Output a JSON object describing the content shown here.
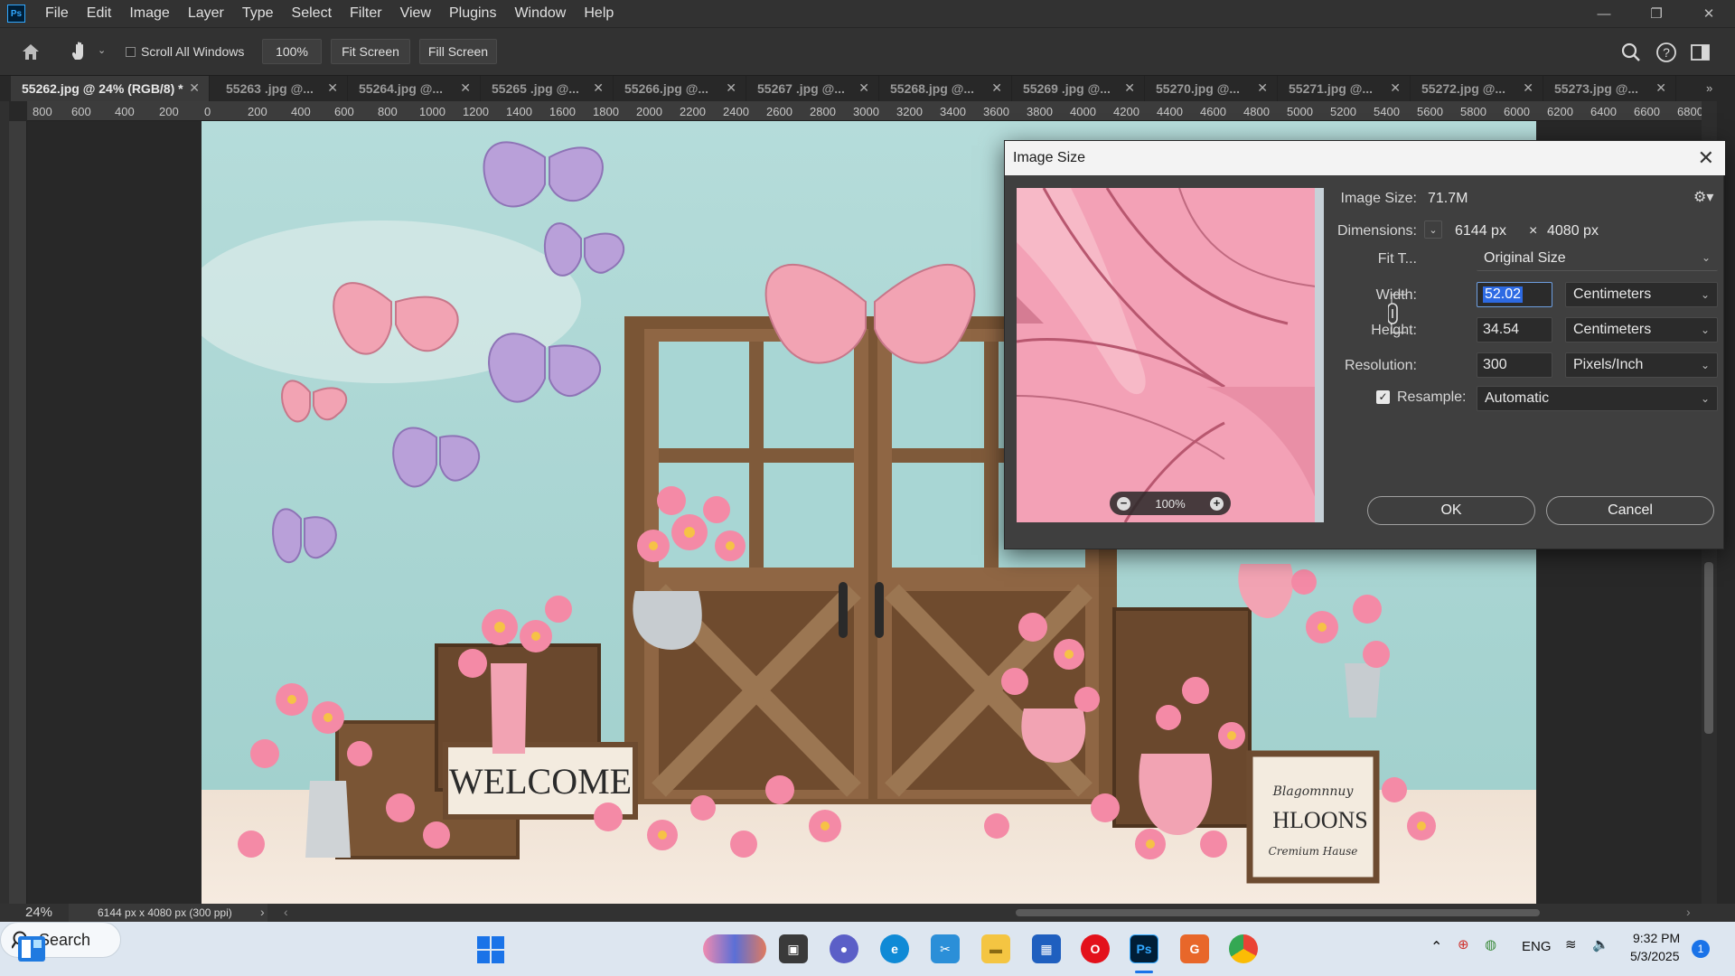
{
  "app": {
    "logo": "Ps"
  },
  "menu": [
    "File",
    "Edit",
    "Image",
    "Layer",
    "Type",
    "Select",
    "Filter",
    "View",
    "Plugins",
    "Window",
    "Help"
  ],
  "window_controls": [
    "minimize-icon",
    "restore-icon",
    "close-icon"
  ],
  "options_bar": {
    "scroll_all_windows": "Scroll All Windows",
    "zoom_btn": "100%",
    "fit_screen": "Fit Screen",
    "fill_screen": "Fill Screen"
  },
  "tabs": [
    {
      "label": "55262.jpg @ 24% (RGB/8) *",
      "active": true
    },
    {
      "label": "55263 .jpg @...",
      "active": false
    },
    {
      "label": "55264.jpg @...",
      "active": false
    },
    {
      "label": "55265 .jpg @...",
      "active": false
    },
    {
      "label": "55266.jpg @...",
      "active": false
    },
    {
      "label": "55267 .jpg @...",
      "active": false
    },
    {
      "label": "55268.jpg @...",
      "active": false
    },
    {
      "label": "55269 .jpg @...",
      "active": false
    },
    {
      "label": "55270.jpg @...",
      "active": false
    },
    {
      "label": "55271.jpg @...",
      "active": false
    },
    {
      "label": "55272.jpg @...",
      "active": false
    },
    {
      "label": "55273.jpg @...",
      "active": false
    }
  ],
  "ruler_h": [
    "800",
    "600",
    "400",
    "200",
    "0",
    "200",
    "400",
    "600",
    "800",
    "1000",
    "1200",
    "1400",
    "1600",
    "1800",
    "2000",
    "2200",
    "2400",
    "2600",
    "2800",
    "3000",
    "3200",
    "3400",
    "3600",
    "3800",
    "4000",
    "4200",
    "4400",
    "4600",
    "4800",
    "5000",
    "5200",
    "5400",
    "5600",
    "5800",
    "6000",
    "6200",
    "6400",
    "6600",
    "6800"
  ],
  "image_text": {
    "welcome_sign": "WELCOME",
    "frame_sign_script": "Blagomnnuy",
    "frame_sign_main": "HLOONS",
    "frame_sign_sub": "Cremium Hause"
  },
  "status": {
    "zoom": "24%",
    "doc_info": "6144 px x 4080 px (300 ppi)"
  },
  "dialog": {
    "title": "Image Size",
    "image_size_label": "Image Size:",
    "image_size_value": "71.7M",
    "dimensions_label": "Dimensions:",
    "dim_width": "6144 px",
    "dim_x": "×",
    "dim_height": "4080 px",
    "fit_to_label": "Fit T...",
    "fit_to_value": "Original Size",
    "width_label": "Width:",
    "width_value": "52.02",
    "width_unit": "Centimeters",
    "height_label": "Height:",
    "height_value": "34.54",
    "height_unit": "Centimeters",
    "resolution_label": "Resolution:",
    "resolution_value": "300",
    "resolution_unit": "Pixels/Inch",
    "resample_label": "Resample:",
    "resample_checked": true,
    "resample_value": "Automatic",
    "preview_zoom": "100%",
    "ok": "OK",
    "cancel": "Cancel"
  },
  "taskbar": {
    "search": "Search",
    "lang": "ENG",
    "time": "9:32 PM",
    "date": "5/3/2025",
    "notification_count": "1"
  },
  "colors": {
    "accent": "#31a8ff",
    "dialog_bg": "#3f3f3f",
    "wall": "#a8d4d2",
    "pink": "#f4a7b9",
    "wood": "#8a6542"
  }
}
